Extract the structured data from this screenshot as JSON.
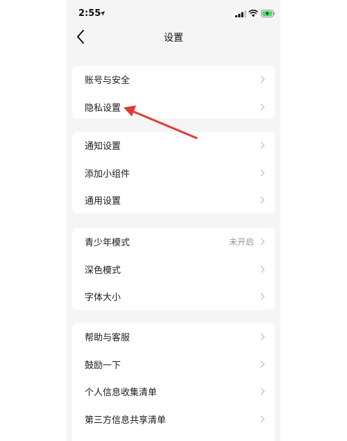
{
  "status_bar": {
    "time": "2:55"
  },
  "nav": {
    "title": "设置"
  },
  "groups": [
    {
      "items": [
        {
          "label": "账号与安全"
        },
        {
          "label": "隐私设置"
        }
      ]
    },
    {
      "items": [
        {
          "label": "通知设置"
        },
        {
          "label": "添加小组件"
        },
        {
          "label": "通用设置"
        }
      ]
    },
    {
      "items": [
        {
          "label": "青少年模式",
          "value": "未开启"
        },
        {
          "label": "深色模式"
        },
        {
          "label": "字体大小"
        }
      ]
    },
    {
      "items": [
        {
          "label": "帮助与客服"
        },
        {
          "label": "鼓励一下"
        },
        {
          "label": "个人信息收集清单"
        },
        {
          "label": "第三方信息共享清单"
        }
      ]
    }
  ],
  "annotation": {
    "color": "#e53935"
  }
}
